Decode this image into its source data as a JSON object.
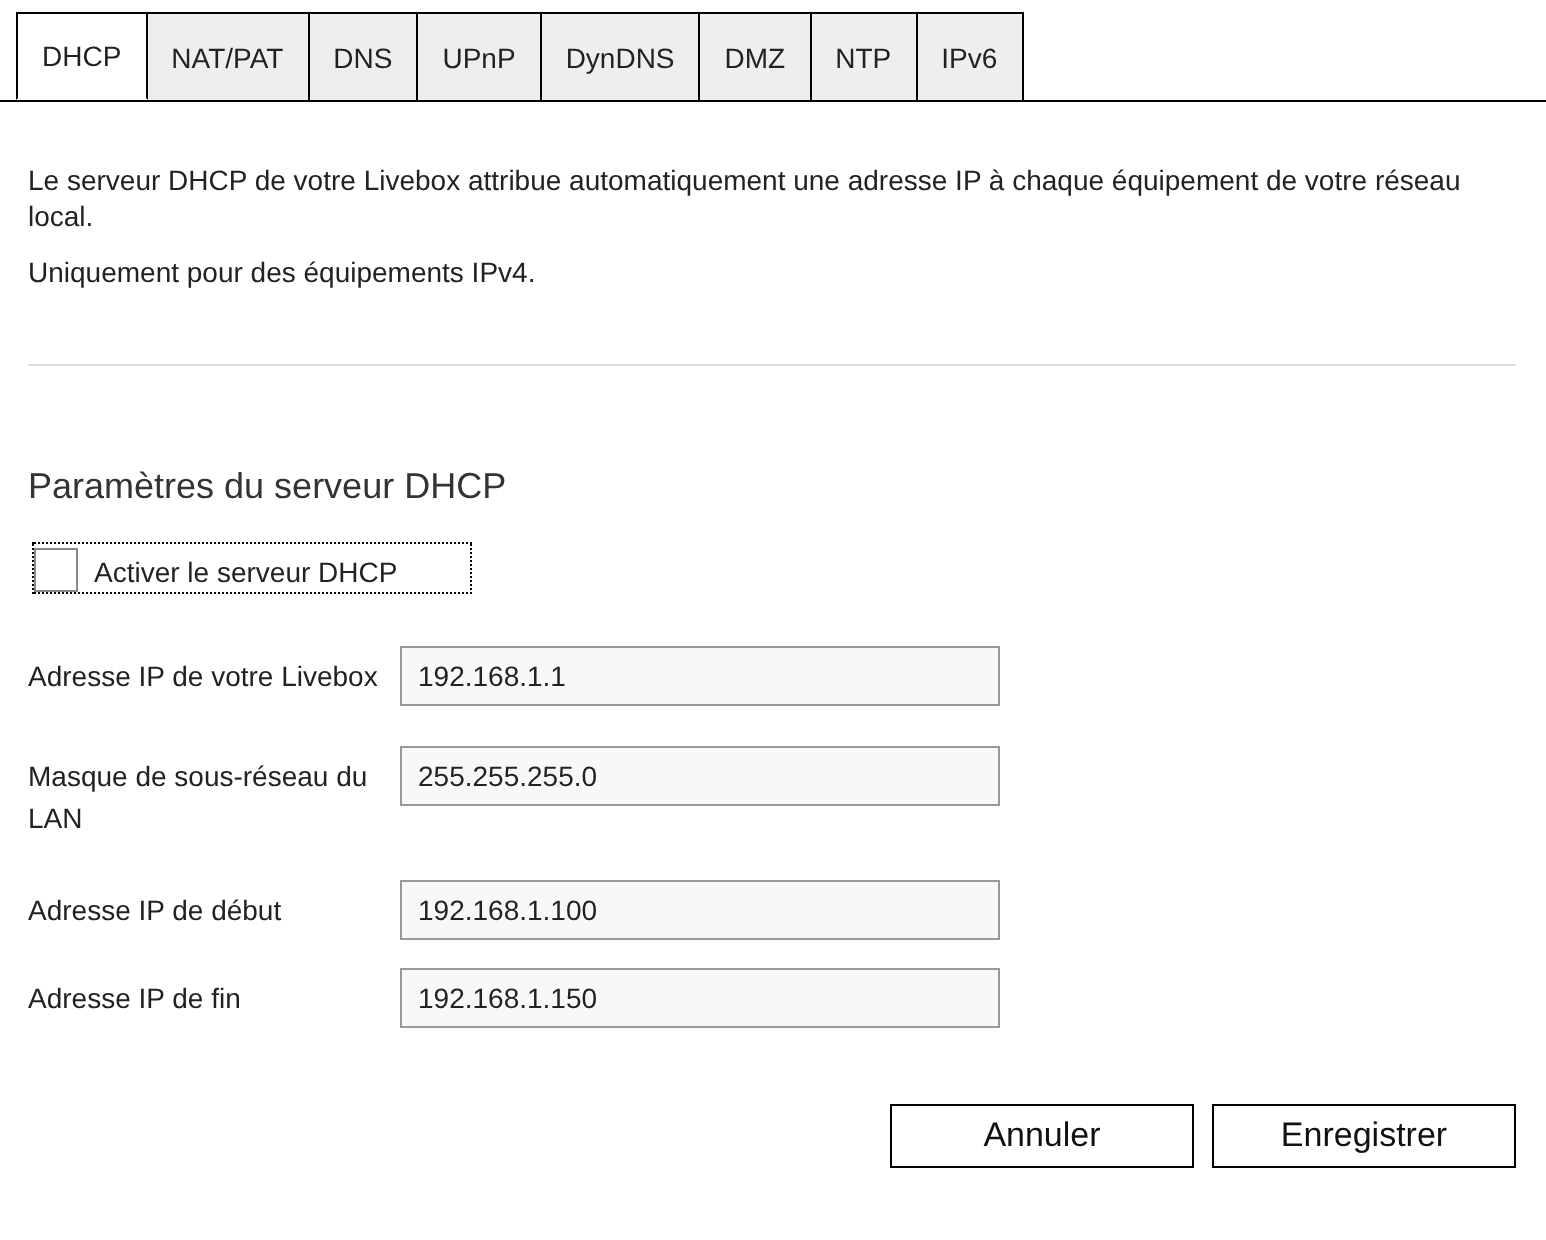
{
  "tabs": [
    {
      "label": "DHCP",
      "selected": true
    },
    {
      "label": "NAT/PAT",
      "selected": false
    },
    {
      "label": "DNS",
      "selected": false
    },
    {
      "label": "UPnP",
      "selected": false
    },
    {
      "label": "DynDNS",
      "selected": false
    },
    {
      "label": "DMZ",
      "selected": false
    },
    {
      "label": "NTP",
      "selected": false
    },
    {
      "label": "IPv6",
      "selected": false
    }
  ],
  "intro": [
    "Le serveur DHCP de votre Livebox attribue automatiquement une adresse IP à chaque équipement de votre réseau local.",
    "Uniquement pour des équipements IPv4."
  ],
  "section_title": "Paramètres du serveur DHCP",
  "enable_checkbox": {
    "label": "Activer le serveur DHCP",
    "checked": false
  },
  "fields": [
    {
      "label": "Adresse IP de votre Livebox",
      "value": "192.168.1.1"
    },
    {
      "label": "Masque de sous-réseau du LAN",
      "value": "255.255.255.0"
    },
    {
      "label": "Adresse IP de début",
      "value": "192.168.1.100"
    },
    {
      "label": "Adresse IP de fin",
      "value": "192.168.1.150"
    }
  ],
  "buttons": [
    "Annuler",
    "Enregistrer"
  ]
}
